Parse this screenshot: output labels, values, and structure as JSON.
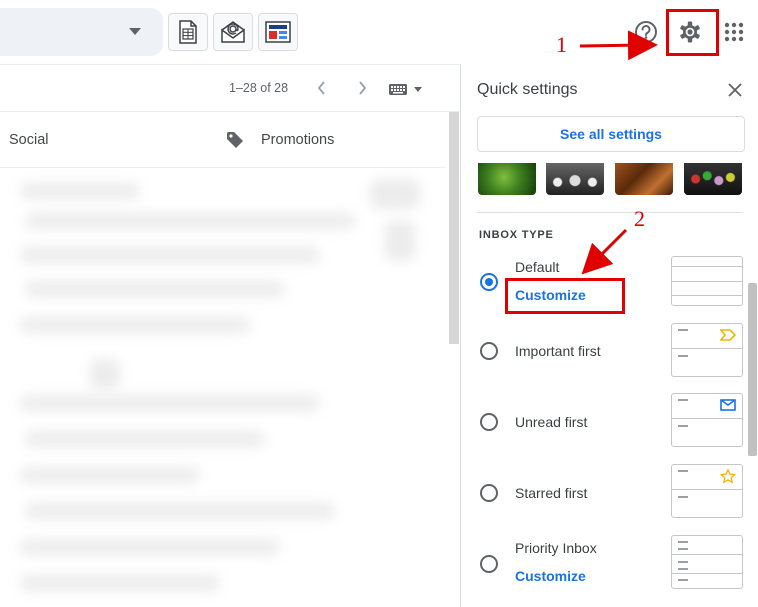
{
  "toolbar": {
    "page_range": "1–28 of 28"
  },
  "tabs": {
    "social": "Social",
    "promotions": "Promotions"
  },
  "quick_settings": {
    "title": "Quick settings",
    "see_all_label": "See all settings",
    "theme_thumbnails": [
      "leaf",
      "water-drops",
      "autumn-leaves",
      "colored-pencils"
    ],
    "inbox_type_heading": "INBOX TYPE",
    "options": [
      {
        "label": "Default",
        "link": "Customize",
        "checked": true,
        "preview_icon": ""
      },
      {
        "label": "Important first",
        "link": "",
        "checked": false,
        "preview_icon": "important-marker-icon"
      },
      {
        "label": "Unread first",
        "link": "",
        "checked": false,
        "preview_icon": "envelope-icon"
      },
      {
        "label": "Starred first",
        "link": "",
        "checked": false,
        "preview_icon": "star-icon"
      },
      {
        "label": "Priority Inbox",
        "link": "Customize",
        "checked": false,
        "preview_icon": ""
      }
    ]
  },
  "annotations": {
    "step1": "1",
    "step2": "2"
  },
  "colors": {
    "accent": "#1a73e8",
    "annotation": "#e00000",
    "important": "#f4b400",
    "star": "#f4b400"
  }
}
